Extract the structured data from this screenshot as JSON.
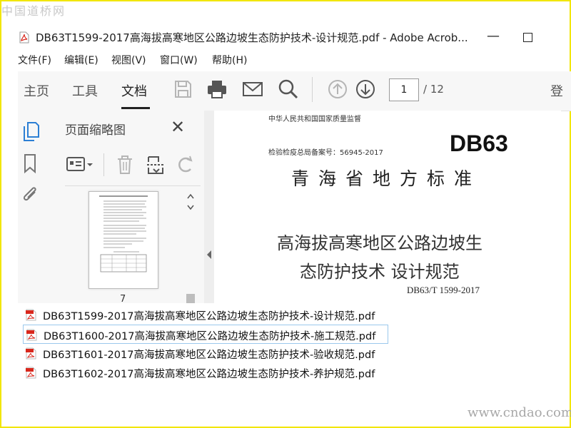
{
  "watermark": {
    "top": "中国道桥网",
    "bottom": "www.cndao.com"
  },
  "window": {
    "title": "DB63T1599-2017高海拔高寒地区公路边坡生态防护技术-设计规范.pdf - Adobe Acrob...",
    "minimize": "—"
  },
  "menubar": {
    "items": [
      "文件(F)",
      "编辑(E)",
      "视图(V)",
      "窗口(W)",
      "帮助(H)"
    ]
  },
  "toolbar": {
    "tabs": [
      "主页",
      "工具",
      "文档"
    ],
    "active_tab": "文档",
    "page_current": "1",
    "page_total": "/ 12",
    "login_label": "登"
  },
  "thumbnails": {
    "title": "页面缩略图",
    "close": "✕",
    "page_number": "7"
  },
  "document": {
    "authority": "中华人民共和国国家质量监督",
    "record_number": "检验检疫总局备案号：56945-2017",
    "code": "DB63",
    "standard_type": "青海省地方标准",
    "title_line1": "高海拔高寒地区公路边坡生",
    "title_line2": "态防护技术  设计规范",
    "standard_id": "DB63/T 1599-2017"
  },
  "files": [
    {
      "name": "DB63T1599-2017高海拔高寒地区公路边坡生态防护技术-设计规范.pdf",
      "selected": false
    },
    {
      "name": "DB63T1600-2017高海拔高寒地区公路边坡生态防护技术-施工规范.pdf",
      "selected": true
    },
    {
      "name": "DB63T1601-2017高海拔高寒地区公路边坡生态防护技术-验收规范.pdf",
      "selected": false
    },
    {
      "name": "DB63T1602-2017高海拔高寒地区公路边坡生态防护技术-养护规范.pdf",
      "selected": false
    }
  ],
  "colors": {
    "frame": "#f2e600",
    "pdf_icon": "#d9271c",
    "selection_border": "#9bc8ec",
    "icon_gray": "#555555",
    "icon_disabled": "#b5b5b5",
    "sidebar_active_icon": "#2c7fd4"
  }
}
